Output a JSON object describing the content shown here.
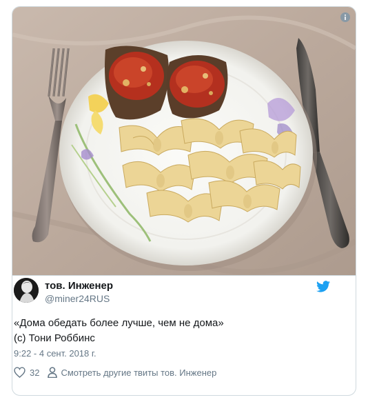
{
  "tweet": {
    "author": {
      "name": "тов. Инженер",
      "handle": "@miner24RUS"
    },
    "text_lines": [
      "«Дома обедать более лучше, чем не дома»",
      "(с) Тони Роббинс"
    ],
    "timestamp": "9:22 - 4 сент. 2018 г.",
    "likes": "32",
    "more_link": "Смотреть другие твиты тов. Инженер"
  },
  "icons": {
    "info": "info-icon",
    "twitter": "twitter-bird-icon",
    "like": "heart-icon",
    "profile": "person-icon"
  },
  "colors": {
    "twitter_blue": "#1da1f2",
    "secondary_text": "#657786",
    "primary_text": "#14171a"
  }
}
